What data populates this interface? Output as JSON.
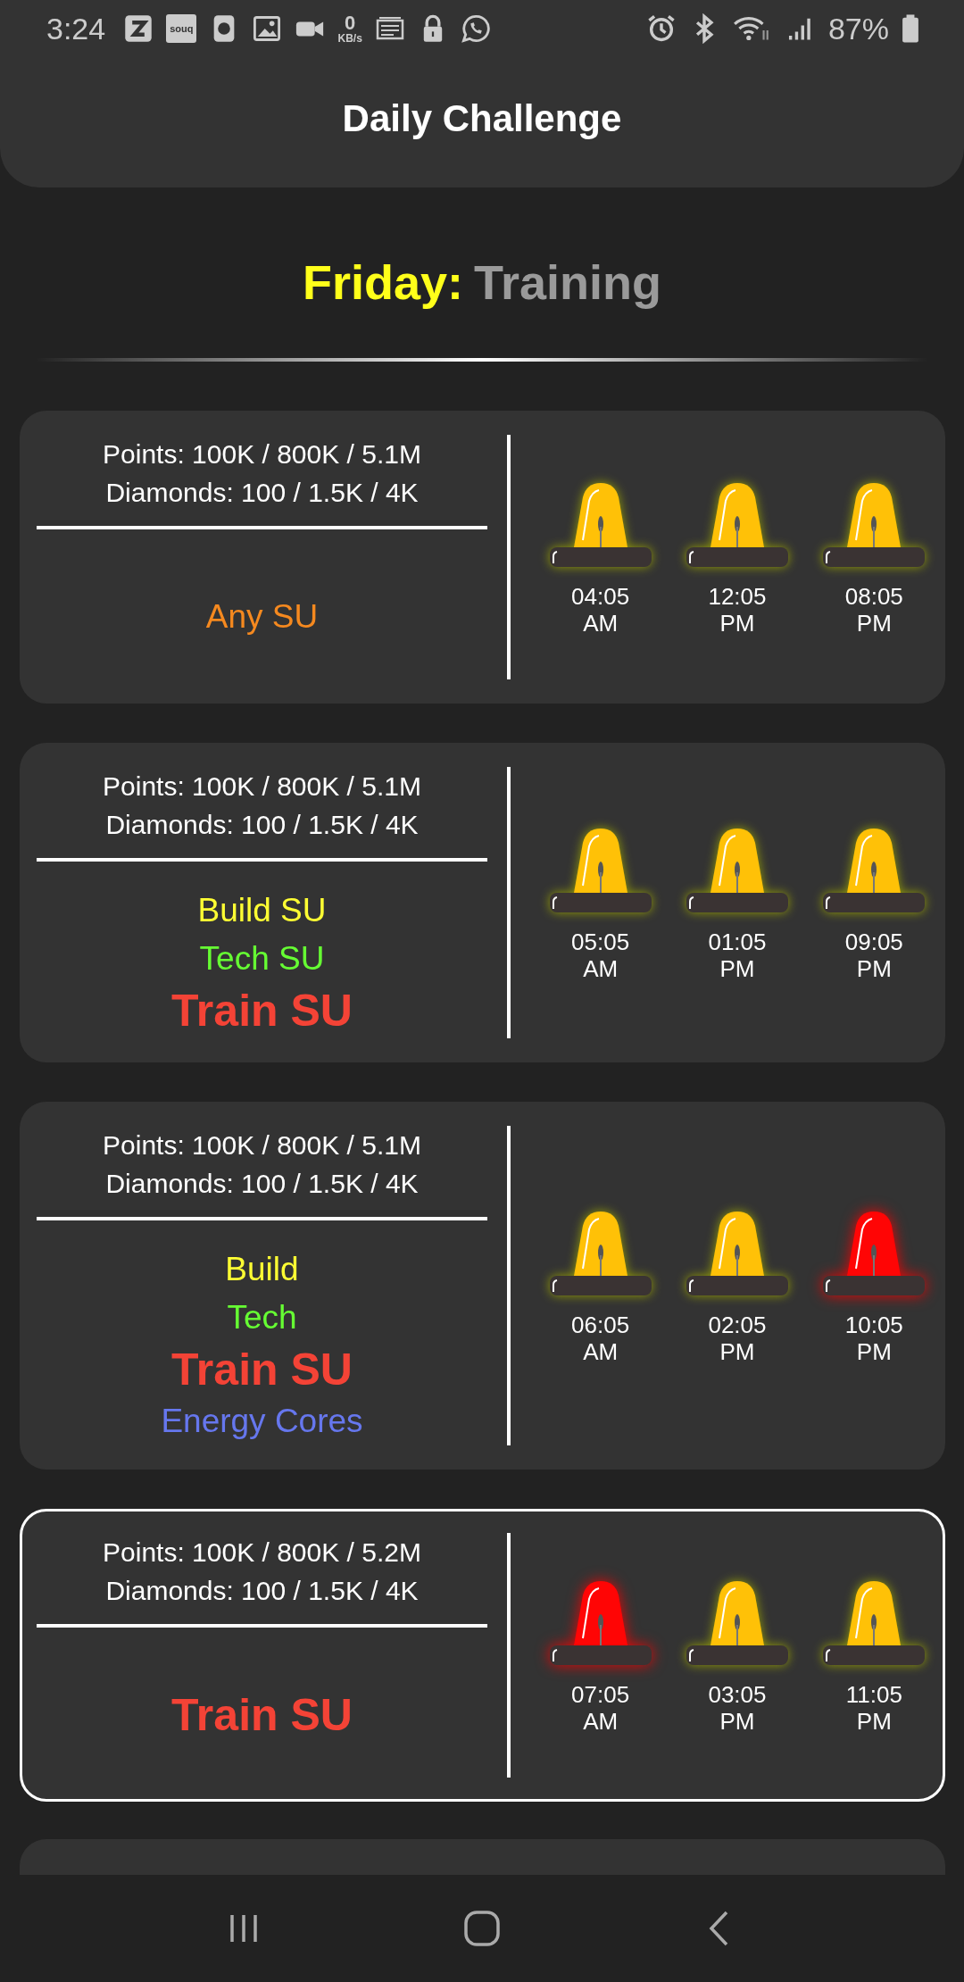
{
  "status_bar": {
    "time": "3:24",
    "app_badge": "souq",
    "speed_value": "0",
    "speed_unit": "KB/s",
    "battery": "87%"
  },
  "header": {
    "title": "Daily Challenge"
  },
  "day": {
    "name": "Friday:",
    "theme": "Training"
  },
  "cards": [
    {
      "selected": false,
      "points": "Points: 100K / 800K / 5.1M",
      "diamonds": "Diamonds: 100 / 1.5K / 4K",
      "objectives": [
        {
          "text": "Any SU",
          "kind": "normal",
          "color": "#f5891f"
        }
      ],
      "alarms": [
        {
          "time": "04:05",
          "period": "AM",
          "active": false
        },
        {
          "time": "12:05",
          "period": "PM",
          "active": false
        },
        {
          "time": "08:05",
          "period": "PM",
          "active": false
        }
      ]
    },
    {
      "selected": false,
      "points": "Points: 100K / 800K / 5.1M",
      "diamonds": "Diamonds: 100 / 1.5K / 4K",
      "objectives": [
        {
          "text": "Build SU",
          "kind": "normal",
          "color": "#ffff33"
        },
        {
          "text": "Tech SU",
          "kind": "normal",
          "color": "#66ff33"
        },
        {
          "text": "Train SU",
          "kind": "big",
          "color": "#f44336"
        }
      ],
      "alarms": [
        {
          "time": "05:05",
          "period": "AM",
          "active": false
        },
        {
          "time": "01:05",
          "period": "PM",
          "active": false
        },
        {
          "time": "09:05",
          "period": "PM",
          "active": false
        }
      ]
    },
    {
      "selected": false,
      "points": "Points: 100K / 800K / 5.1M",
      "diamonds": "Diamonds: 100 / 1.5K / 4K",
      "objectives": [
        {
          "text": "Build",
          "kind": "normal",
          "color": "#ffff33"
        },
        {
          "text": "Tech",
          "kind": "normal",
          "color": "#66ff33"
        },
        {
          "text": "Train SU",
          "kind": "big",
          "color": "#f44336"
        },
        {
          "text": "Energy Cores",
          "kind": "normal",
          "color": "#6677ee"
        }
      ],
      "alarms": [
        {
          "time": "06:05",
          "period": "AM",
          "active": false
        },
        {
          "time": "02:05",
          "period": "PM",
          "active": false
        },
        {
          "time": "10:05",
          "period": "PM",
          "active": true
        }
      ]
    },
    {
      "selected": true,
      "points": "Points: 100K / 800K / 5.2M",
      "diamonds": "Diamonds: 100 / 1.5K / 4K",
      "objectives": [
        {
          "text": "Train SU",
          "kind": "big",
          "color": "#f44336"
        }
      ],
      "alarms": [
        {
          "time": "07:05",
          "period": "AM",
          "active": true
        },
        {
          "time": "03:05",
          "period": "PM",
          "active": false
        },
        {
          "time": "11:05",
          "period": "PM",
          "active": false
        }
      ]
    }
  ]
}
